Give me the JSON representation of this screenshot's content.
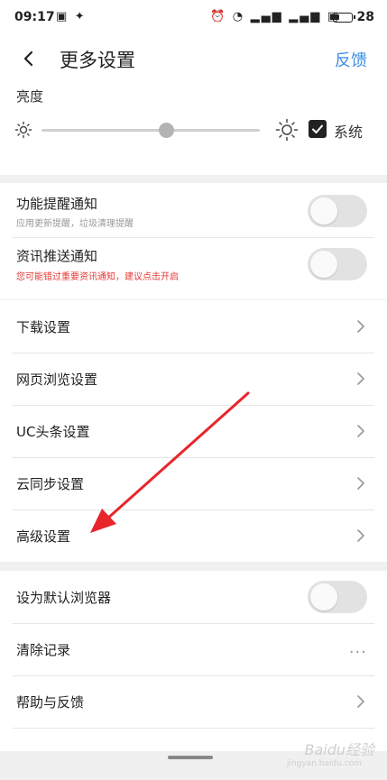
{
  "status_bar": {
    "time": "09:17",
    "battery": "28"
  },
  "header": {
    "title": "更多设置",
    "feedback": "反馈"
  },
  "brightness": {
    "label": "亮度",
    "system_label": "系统",
    "level": 0.57,
    "system_checked": true
  },
  "notifications": [
    {
      "label": "功能提醒通知",
      "sub": "应用更新提醒，垃圾清理提醒",
      "sub_warning": false,
      "enabled": false
    },
    {
      "label": "资讯推送通知",
      "sub": "您可能错过重要资讯通知，建议点击开启",
      "sub_warning": true,
      "enabled": false
    }
  ],
  "settings_list": [
    {
      "label": "下载设置"
    },
    {
      "label": "网页浏览设置"
    },
    {
      "label": "UC头条设置"
    },
    {
      "label": "云同步设置"
    },
    {
      "label": "高级设置"
    }
  ],
  "bottom_list": [
    {
      "label": "设为默认浏览器",
      "control": "toggle",
      "enabled": false
    },
    {
      "label": "清除记录",
      "control": "more"
    },
    {
      "label": "帮助与反馈",
      "control": "chevron"
    }
  ],
  "watermark": {
    "text": "Baidu经验",
    "sub": "jingyan.baidu.com"
  },
  "colors": {
    "accent": "#3b8ee6",
    "warning": "#e53935",
    "annotation_arrow": "#e8252b"
  }
}
